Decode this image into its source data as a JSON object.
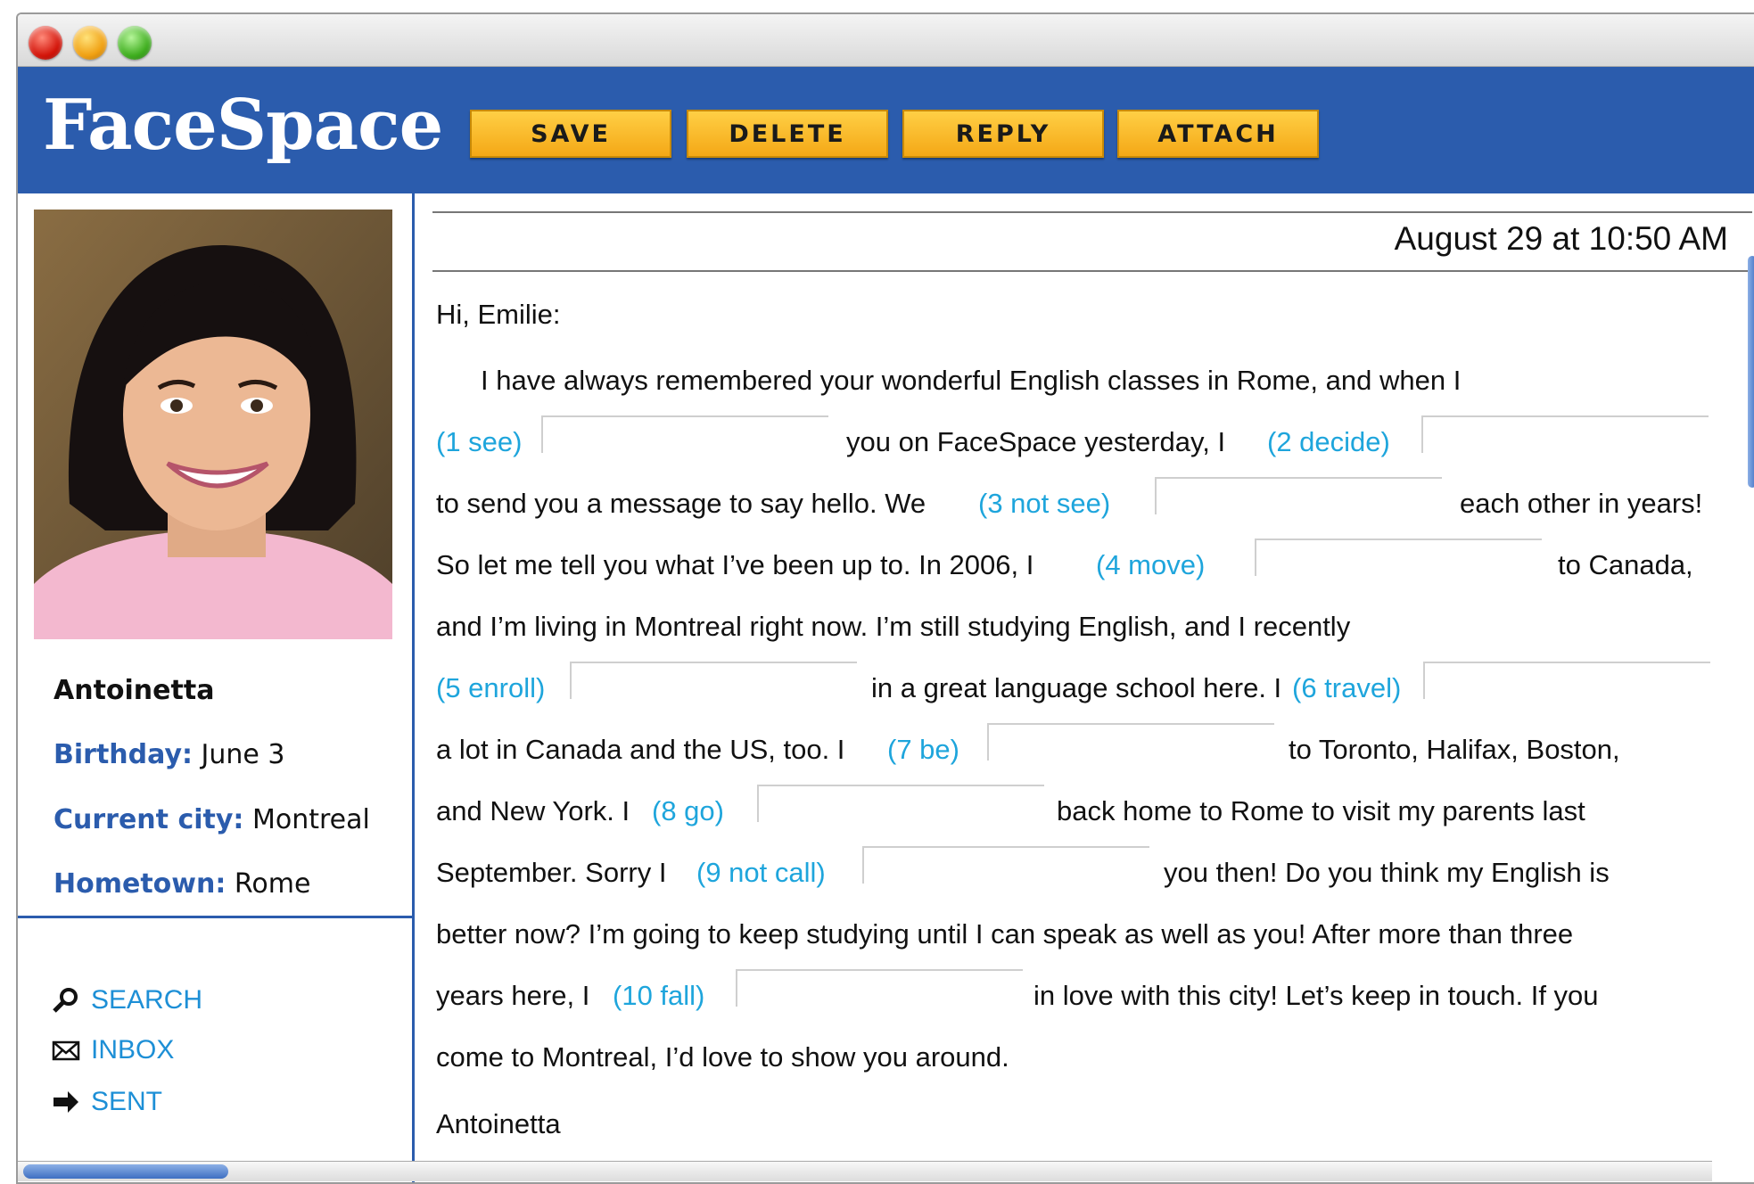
{
  "app": {
    "logo": "FaceSpace"
  },
  "toolbar": {
    "save": "SAVE",
    "delete": "DELETE",
    "reply": "REPLY",
    "attach": "ATTACH"
  },
  "profile": {
    "name": "Antoinetta",
    "birthday_label": "Birthday:",
    "birthday": "June 3",
    "city_label": "Current city:",
    "city": "Montreal",
    "hometown_label": "Hometown:",
    "hometown": "Rome"
  },
  "nav": {
    "search": "SEARCH",
    "inbox": "INBOX",
    "sent": "SENT"
  },
  "message": {
    "timestamp": "August 29 at 10:50 AM",
    "greeting": "Hi, Emilie:",
    "l1": "I have always remembered your wonderful English classes in Rome, and when I",
    "l2a": "(1  see)",
    "l2b": "you on FaceSpace yesterday, I",
    "l2c": "(2  decide)",
    "l3a": "to send you a message to say hello. We",
    "l3b": "(3  not see)",
    "l3c": "each other in years!",
    "l4a": "So let me tell you what I’ve been up to. In 2006, I",
    "l4b": "(4  move)",
    "l4c": "to Canada,",
    "l5": "and I’m living in Montreal right now. I’m still studying English, and I recently",
    "l6a": "(5  enroll)",
    "l6b": "in a great language school here. I",
    "l6c": "(6  travel)",
    "l7a": "a lot in Canada and the US, too. I",
    "l7b": "(7  be)",
    "l7c": "to Toronto, Halifax, Boston,",
    "l8a": "and New York. I",
    "l8b": "(8  go)",
    "l8c": "back home to Rome to visit my parents last",
    "l9a": "September. Sorry I",
    "l9b": "(9  not call)",
    "l9c": "you then! Do you think my English is",
    "l10": "better now? I’m going to keep studying until I can speak as well as you! After more than three",
    "l11a": "years here, I",
    "l11b": "(10  fall)",
    "l11c": "in love with this city! Let’s keep in touch. If you",
    "l12": "come to Montreal, I’d love to show you around.",
    "signature": "Antoinetta"
  }
}
